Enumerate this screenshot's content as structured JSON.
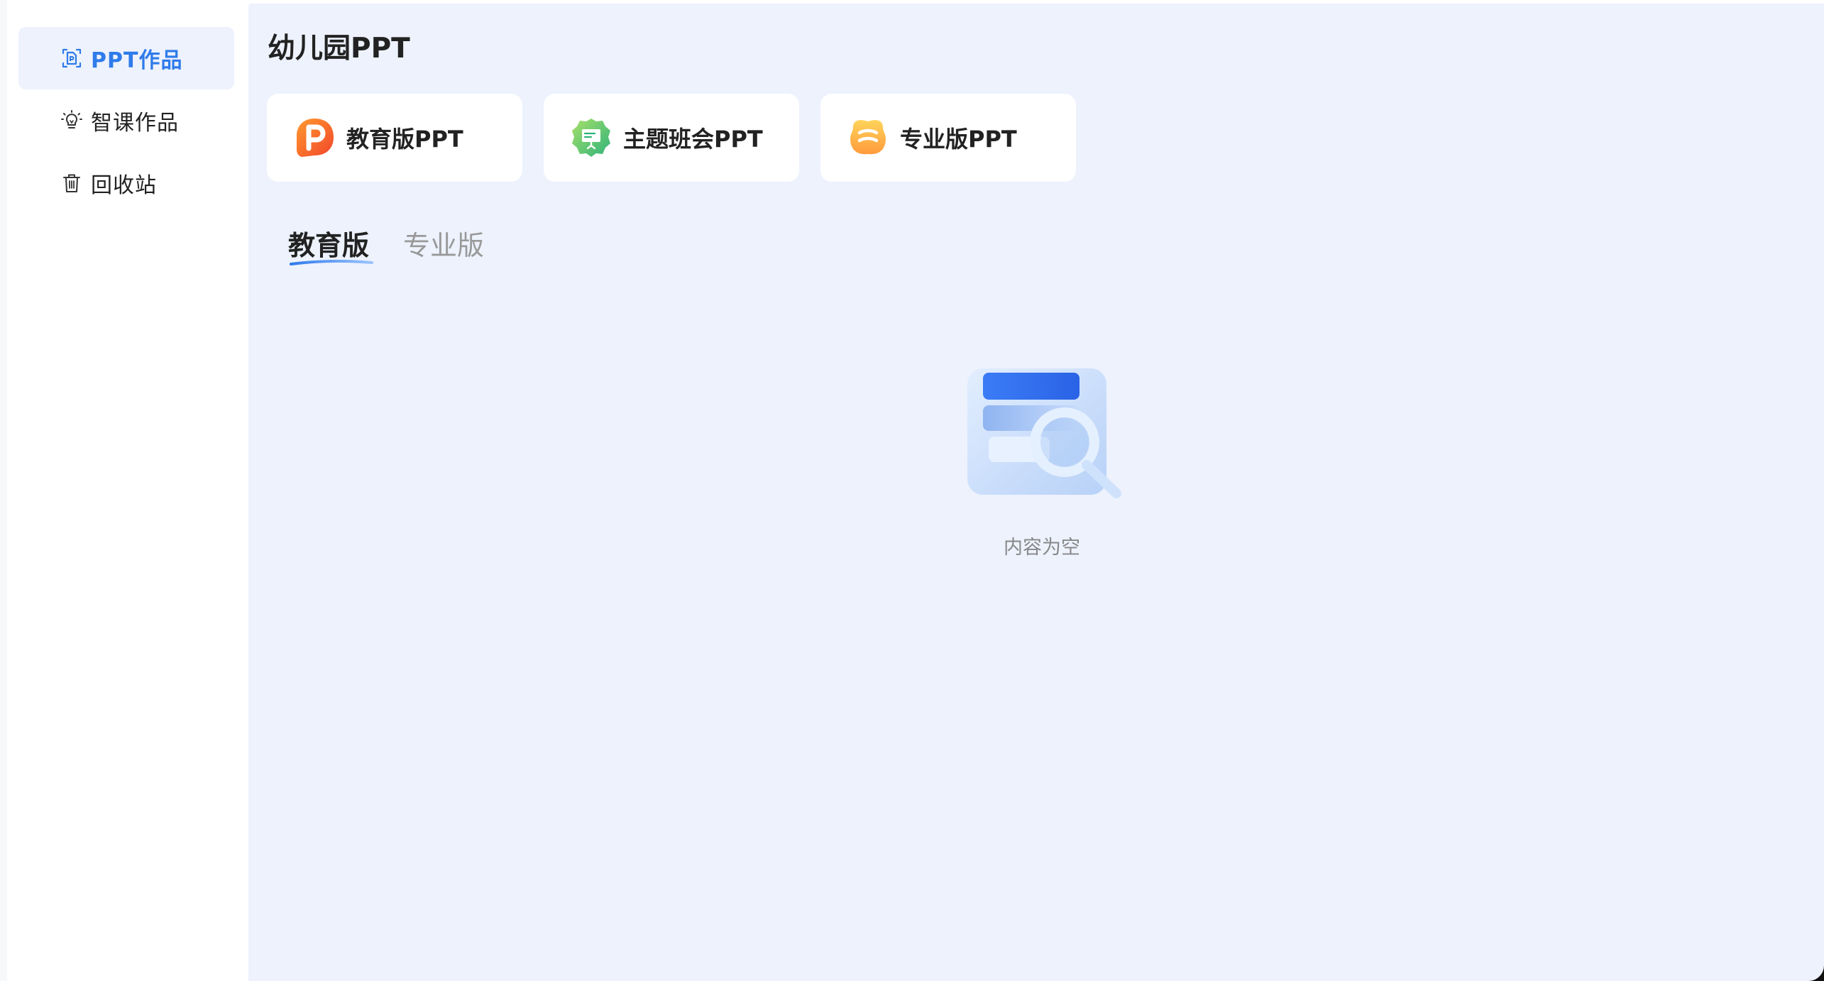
{
  "sidebar": {
    "items": [
      {
        "label": "PPT作品",
        "icon": "ppt-file-icon",
        "active": true
      },
      {
        "label": "智课作品",
        "icon": "lightbulb-icon",
        "active": false
      },
      {
        "label": "回收站",
        "icon": "trash-icon",
        "active": false
      }
    ]
  },
  "main": {
    "title": "幼儿园PPT",
    "cards": [
      {
        "label": "教育版PPT",
        "icon": "education-ppt-icon"
      },
      {
        "label": "主题班会PPT",
        "icon": "class-meeting-ppt-icon"
      },
      {
        "label": "专业版PPT",
        "icon": "pro-ppt-icon"
      }
    ],
    "tabs": [
      {
        "label": "教育版",
        "active": true
      },
      {
        "label": "专业版",
        "active": false
      }
    ],
    "empty_text": "内容为空"
  },
  "colors": {
    "accent": "#2f7bea",
    "main_bg": "#edf2fd",
    "sidebar_active_bg": "#edf2fd",
    "text_primary": "#222222",
    "text_muted": "#999999"
  }
}
